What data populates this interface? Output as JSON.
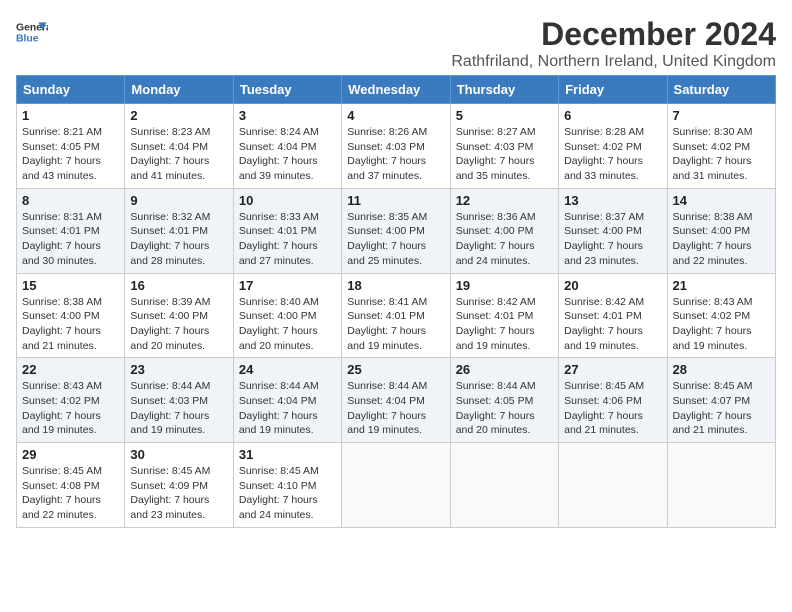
{
  "header": {
    "logo_line1": "General",
    "logo_line2": "Blue",
    "month_title": "December 2024",
    "location": "Rathfriland, Northern Ireland, United Kingdom"
  },
  "weekdays": [
    "Sunday",
    "Monday",
    "Tuesday",
    "Wednesday",
    "Thursday",
    "Friday",
    "Saturday"
  ],
  "weeks": [
    [
      {
        "day": "1",
        "sunrise": "8:21 AM",
        "sunset": "4:05 PM",
        "daylight": "7 hours and 43 minutes."
      },
      {
        "day": "2",
        "sunrise": "8:23 AM",
        "sunset": "4:04 PM",
        "daylight": "7 hours and 41 minutes."
      },
      {
        "day": "3",
        "sunrise": "8:24 AM",
        "sunset": "4:04 PM",
        "daylight": "7 hours and 39 minutes."
      },
      {
        "day": "4",
        "sunrise": "8:26 AM",
        "sunset": "4:03 PM",
        "daylight": "7 hours and 37 minutes."
      },
      {
        "day": "5",
        "sunrise": "8:27 AM",
        "sunset": "4:03 PM",
        "daylight": "7 hours and 35 minutes."
      },
      {
        "day": "6",
        "sunrise": "8:28 AM",
        "sunset": "4:02 PM",
        "daylight": "7 hours and 33 minutes."
      },
      {
        "day": "7",
        "sunrise": "8:30 AM",
        "sunset": "4:02 PM",
        "daylight": "7 hours and 31 minutes."
      }
    ],
    [
      {
        "day": "8",
        "sunrise": "8:31 AM",
        "sunset": "4:01 PM",
        "daylight": "7 hours and 30 minutes."
      },
      {
        "day": "9",
        "sunrise": "8:32 AM",
        "sunset": "4:01 PM",
        "daylight": "7 hours and 28 minutes."
      },
      {
        "day": "10",
        "sunrise": "8:33 AM",
        "sunset": "4:01 PM",
        "daylight": "7 hours and 27 minutes."
      },
      {
        "day": "11",
        "sunrise": "8:35 AM",
        "sunset": "4:00 PM",
        "daylight": "7 hours and 25 minutes."
      },
      {
        "day": "12",
        "sunrise": "8:36 AM",
        "sunset": "4:00 PM",
        "daylight": "7 hours and 24 minutes."
      },
      {
        "day": "13",
        "sunrise": "8:37 AM",
        "sunset": "4:00 PM",
        "daylight": "7 hours and 23 minutes."
      },
      {
        "day": "14",
        "sunrise": "8:38 AM",
        "sunset": "4:00 PM",
        "daylight": "7 hours and 22 minutes."
      }
    ],
    [
      {
        "day": "15",
        "sunrise": "8:38 AM",
        "sunset": "4:00 PM",
        "daylight": "7 hours and 21 minutes."
      },
      {
        "day": "16",
        "sunrise": "8:39 AM",
        "sunset": "4:00 PM",
        "daylight": "7 hours and 20 minutes."
      },
      {
        "day": "17",
        "sunrise": "8:40 AM",
        "sunset": "4:00 PM",
        "daylight": "7 hours and 20 minutes."
      },
      {
        "day": "18",
        "sunrise": "8:41 AM",
        "sunset": "4:01 PM",
        "daylight": "7 hours and 19 minutes."
      },
      {
        "day": "19",
        "sunrise": "8:42 AM",
        "sunset": "4:01 PM",
        "daylight": "7 hours and 19 minutes."
      },
      {
        "day": "20",
        "sunrise": "8:42 AM",
        "sunset": "4:01 PM",
        "daylight": "7 hours and 19 minutes."
      },
      {
        "day": "21",
        "sunrise": "8:43 AM",
        "sunset": "4:02 PM",
        "daylight": "7 hours and 19 minutes."
      }
    ],
    [
      {
        "day": "22",
        "sunrise": "8:43 AM",
        "sunset": "4:02 PM",
        "daylight": "7 hours and 19 minutes."
      },
      {
        "day": "23",
        "sunrise": "8:44 AM",
        "sunset": "4:03 PM",
        "daylight": "7 hours and 19 minutes."
      },
      {
        "day": "24",
        "sunrise": "8:44 AM",
        "sunset": "4:04 PM",
        "daylight": "7 hours and 19 minutes."
      },
      {
        "day": "25",
        "sunrise": "8:44 AM",
        "sunset": "4:04 PM",
        "daylight": "7 hours and 19 minutes."
      },
      {
        "day": "26",
        "sunrise": "8:44 AM",
        "sunset": "4:05 PM",
        "daylight": "7 hours and 20 minutes."
      },
      {
        "day": "27",
        "sunrise": "8:45 AM",
        "sunset": "4:06 PM",
        "daylight": "7 hours and 21 minutes."
      },
      {
        "day": "28",
        "sunrise": "8:45 AM",
        "sunset": "4:07 PM",
        "daylight": "7 hours and 21 minutes."
      }
    ],
    [
      {
        "day": "29",
        "sunrise": "8:45 AM",
        "sunset": "4:08 PM",
        "daylight": "7 hours and 22 minutes."
      },
      {
        "day": "30",
        "sunrise": "8:45 AM",
        "sunset": "4:09 PM",
        "daylight": "7 hours and 23 minutes."
      },
      {
        "day": "31",
        "sunrise": "8:45 AM",
        "sunset": "4:10 PM",
        "daylight": "7 hours and 24 minutes."
      },
      null,
      null,
      null,
      null
    ]
  ]
}
